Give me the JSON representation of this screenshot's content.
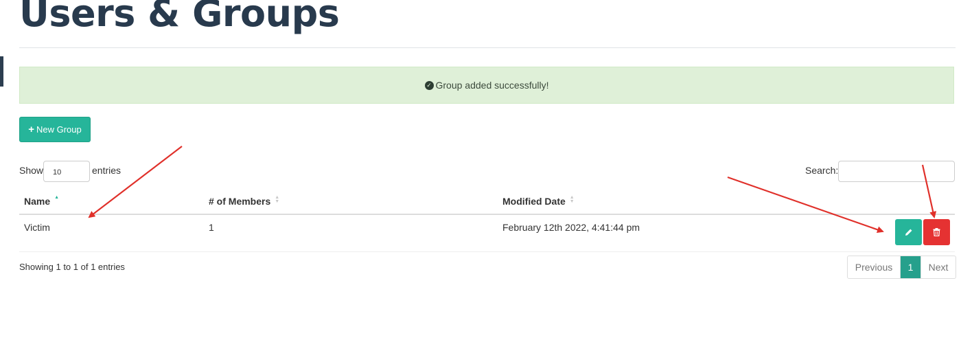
{
  "page": {
    "title": "Users & Groups"
  },
  "alert": {
    "icon": "check-circle-icon",
    "message": "Group added successfully!"
  },
  "toolbar": {
    "new_group_icon": "plus-icon",
    "new_group_label": "New Group"
  },
  "table_controls": {
    "show_label": "Show",
    "page_length": "10",
    "entries_label": "entries",
    "search_label": "Search:",
    "search_value": ""
  },
  "table": {
    "columns": [
      {
        "label": "Name",
        "sort": "ascending"
      },
      {
        "label": "# of Members",
        "sort": "none"
      },
      {
        "label": "Modified Date",
        "sort": "none"
      }
    ],
    "rows": [
      {
        "name": "Victim",
        "members": "1",
        "modified": "February 12th 2022, 4:41:44 pm",
        "actions": [
          "pencil-icon",
          "trash-icon"
        ]
      }
    ]
  },
  "footer": {
    "info": "Showing 1 to 1 of 1 entries",
    "pagination": {
      "previous": "Previous",
      "current": "1",
      "next": "Next"
    }
  },
  "colors": {
    "title": "#283a4d",
    "accent": "#26b59a",
    "danger": "#e53232",
    "alert_bg": "#dff0d8",
    "annotation_arrow": "#e0302a"
  }
}
